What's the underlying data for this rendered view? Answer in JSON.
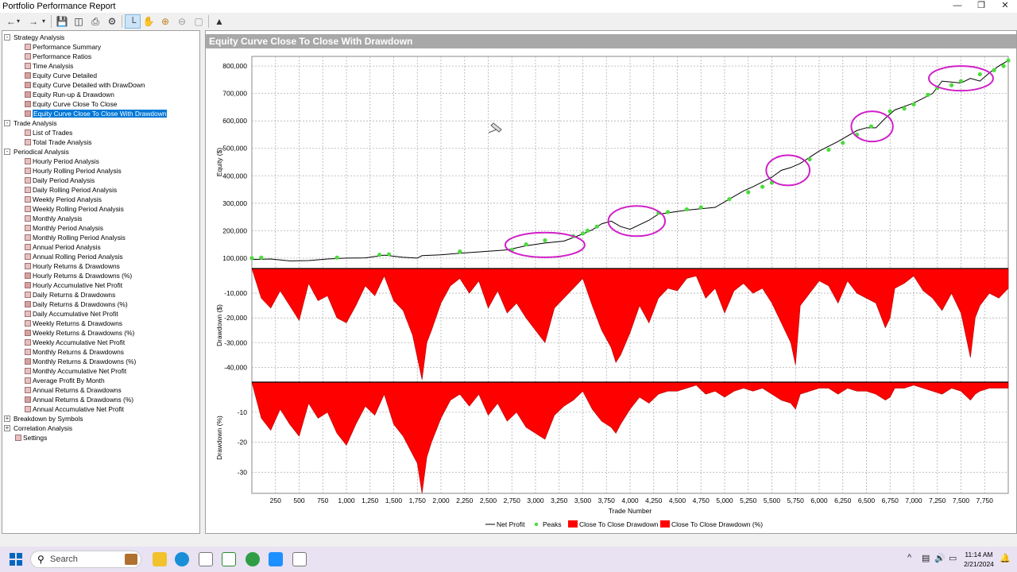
{
  "window": {
    "title": "Portfolio Performance Report"
  },
  "toolbar": {
    "buttons": [
      "back-icon",
      "forward-icon",
      "dropdown-icon",
      "save-icon",
      "export-icon",
      "print-icon",
      "settings-icon",
      "crosshair-icon",
      "pan-icon",
      "zoom-in-icon",
      "zoom-out-icon",
      "zoom-reset-icon",
      "chart-icon"
    ]
  },
  "tree": {
    "nodes": [
      {
        "label": "Strategy Analysis",
        "level": 0,
        "expander": "-"
      },
      {
        "label": "Performance Summary",
        "level": 1
      },
      {
        "label": "Performance Ratios",
        "level": 1
      },
      {
        "label": "Time Analysis",
        "level": 1
      },
      {
        "label": "Equity Curve Detailed",
        "level": 1,
        "checked": true
      },
      {
        "label": "Equity Curve Detailed with DrawDown",
        "level": 1,
        "checked": true
      },
      {
        "label": "Equity Run-up & Drawdown",
        "level": 1,
        "checked": true
      },
      {
        "label": "Equity Curve Close To Close",
        "level": 1,
        "checked": true
      },
      {
        "label": "Equity Curve Close To Close With Drawdown",
        "level": 1,
        "checked": true,
        "selected": true
      },
      {
        "label": "Trade Analysis",
        "level": 0,
        "expander": "-"
      },
      {
        "label": "List of Trades",
        "level": 1
      },
      {
        "label": "Total Trade Analysis",
        "level": 1
      },
      {
        "label": "Periodical Analysis",
        "level": 0,
        "expander": "-"
      },
      {
        "label": "Hourly Period Analysis",
        "level": 1
      },
      {
        "label": "Hourly Rolling Period Analysis",
        "level": 1
      },
      {
        "label": "Daily Period Analysis",
        "level": 1
      },
      {
        "label": "Daily Rolling Period Analysis",
        "level": 1
      },
      {
        "label": "Weekly Period Analysis",
        "level": 1
      },
      {
        "label": "Weekly Rolling Period Analysis",
        "level": 1
      },
      {
        "label": "Monthly Analysis",
        "level": 1
      },
      {
        "label": "Monthly Period Analysis",
        "level": 1
      },
      {
        "label": "Monthly Rolling Period Analysis",
        "level": 1
      },
      {
        "label": "Annual Period Analysis",
        "level": 1
      },
      {
        "label": "Annual Rolling Period Analysis",
        "level": 1
      },
      {
        "label": "Hourly Returns & Drawdowns",
        "level": 1
      },
      {
        "label": "Hourly Returns & Drawdowns (%)",
        "level": 1,
        "checked": true
      },
      {
        "label": "Hourly Accumulative Net Profit",
        "level": 1,
        "checked": true
      },
      {
        "label": "Daily Returns & Drawdowns",
        "level": 1
      },
      {
        "label": "Daily Returns & Drawdowns (%)",
        "level": 1,
        "checked": true
      },
      {
        "label": "Daily Accumulative Net Profit",
        "level": 1
      },
      {
        "label": "Weekly Returns & Drawdowns",
        "level": 1
      },
      {
        "label": "Weekly Returns & Drawdowns (%)",
        "level": 1,
        "checked": true
      },
      {
        "label": "Weekly Accumulative Net Profit",
        "level": 1
      },
      {
        "label": "Monthly Returns & Drawdowns",
        "level": 1
      },
      {
        "label": "Monthly Returns & Drawdowns (%)",
        "level": 1,
        "checked": true
      },
      {
        "label": "Monthly Accumulative Net Profit",
        "level": 1
      },
      {
        "label": "Average Profit By Month",
        "level": 1
      },
      {
        "label": "Annual Returns & Drawdowns",
        "level": 1
      },
      {
        "label": "Annual Returns & Drawdowns (%)",
        "level": 1,
        "checked": true
      },
      {
        "label": "Annual Accumulative Net Profit",
        "level": 1
      },
      {
        "label": "Breakdown by Symbols",
        "level": 0,
        "expander": "+"
      },
      {
        "label": "Correlation Analysis",
        "level": 0,
        "expander": "+"
      },
      {
        "label": "Settings",
        "level": 0.5
      }
    ]
  },
  "chart_header": "Equity Curve Close To Close With Drawdown",
  "chart_data": {
    "type": "line",
    "title": "Equity Curve Close To Close With Drawdown",
    "xlabel": "Trade Number",
    "x_ticks": [
      "250",
      "500",
      "750",
      "1,000",
      "1,250",
      "1,500",
      "1,750",
      "2,000",
      "2,250",
      "2,500",
      "2,750",
      "3,000",
      "3,250",
      "3,500",
      "3,750",
      "4,000",
      "4,250",
      "4,500",
      "4,750",
      "5,000",
      "5,250",
      "5,500",
      "5,750",
      "6,000",
      "6,250",
      "6,500",
      "6,750",
      "7,000",
      "7,250",
      "7,500",
      "7,750"
    ],
    "xlim": [
      0,
      8000
    ],
    "panels": [
      {
        "ylabel": "Equity ($)",
        "y_ticks": [
          "100,000",
          "200,000",
          "300,000",
          "400,000",
          "500,000",
          "600,000",
          "700,000",
          "800,000"
        ],
        "ylim": [
          65000,
          835000
        ],
        "series": [
          {
            "name": "Net Profit",
            "x": [
              0,
              200,
              400,
              600,
              800,
              1000,
              1200,
              1400,
              1600,
              1750,
              1800,
              2000,
              2200,
              2500,
              2700,
              2900,
              3100,
              3300,
              3500,
              3600,
              3700,
              3800,
              3900,
              4000,
              4200,
              4300,
              4600,
              4900,
              5000,
              5200,
              5300,
              5500,
              5600,
              5700,
              5800,
              6000,
              6200,
              6400,
              6500,
              6600,
              6700,
              6800,
              7000,
              7200,
              7300,
              7500,
              7600,
              7700,
              7800,
              7900,
              8000
            ],
            "y": [
              95000,
              97000,
              90000,
              91000,
              97000,
              100000,
              101000,
              111000,
              103000,
              100000,
              109000,
              112000,
              118000,
              125000,
              130000,
              145000,
              155000,
              162000,
              188000,
              203000,
              225000,
              235000,
              215000,
              205000,
              238000,
              260000,
              275000,
              285000,
              305000,
              345000,
              360000,
              395000,
              420000,
              430000,
              445000,
              490000,
              525000,
              565000,
              575000,
              575000,
              610000,
              640000,
              665000,
              700000,
              745000,
              738000,
              755000,
              745000,
              775000,
              800000,
              820000
            ]
          },
          {
            "name": "Peaks",
            "x": [
              0,
              100,
              900,
              1350,
              1450,
              2200,
              2750,
              2900,
              3100,
              3400,
              3500,
              3550,
              3650,
              4300,
              4400,
              4600,
              4750,
              5050,
              5250,
              5400,
              5500,
              5900,
              6100,
              6250,
              6400,
              6550,
              6750,
              6900,
              7000,
              7150,
              7250,
              7400,
              7500,
              7700,
              7850,
              7950,
              8000
            ],
            "y": [
              100000,
              102000,
              102000,
              112000,
              114000,
              124000,
              130000,
              150000,
              165000,
              180000,
              190000,
              200000,
              215000,
              265000,
              268000,
              278000,
              285000,
              315000,
              340000,
              360000,
              375000,
              460000,
              495000,
              520000,
              550000,
              580000,
              635000,
              645000,
              660000,
              695000,
              720000,
              730000,
              745000,
              770000,
              785000,
              800000,
              820000
            ]
          }
        ]
      },
      {
        "ylabel": "Drawdown ($)",
        "y_ticks": [
          "-10,000",
          "-20,000",
          "-30,000",
          "-40,000"
        ],
        "ylim": [
          -46000,
          0
        ],
        "series": [
          {
            "name": "Close To Close Drawdown",
            "x": [
              0,
              100,
              200,
              300,
              400,
              500,
              600,
              700,
              800,
              900,
              1000,
              1100,
              1200,
              1300,
              1400,
              1500,
              1600,
              1700,
              1750,
              1800,
              1850,
              1900,
              2000,
              2100,
              2200,
              2300,
              2400,
              2500,
              2600,
              2700,
              2800,
              2900,
              3000,
              3100,
              3200,
              3300,
              3400,
              3500,
              3600,
              3700,
              3800,
              3850,
              3900,
              4000,
              4100,
              4200,
              4300,
              4400,
              4500,
              4600,
              4700,
              4800,
              4900,
              5000,
              5100,
              5200,
              5300,
              5400,
              5500,
              5600,
              5700,
              5750,
              5800,
              5900,
              6000,
              6100,
              6200,
              6300,
              6400,
              6500,
              6600,
              6700,
              6750,
              6800,
              6900,
              7000,
              7100,
              7200,
              7300,
              7400,
              7500,
              7600,
              7650,
              7700,
              7800,
              7900,
              8000
            ],
            "y": [
              0,
              -12000,
              -16000,
              -9000,
              -15000,
              -21000,
              -6000,
              -13000,
              -11000,
              -20000,
              -22000,
              -15000,
              -7000,
              -11000,
              -3000,
              -13000,
              -17000,
              -27000,
              -36000,
              -45000,
              -30000,
              -25000,
              -14000,
              -7000,
              -4000,
              -10000,
              -5000,
              -16000,
              -9000,
              -18000,
              -14000,
              -20000,
              -25000,
              -30000,
              -16000,
              -12000,
              -8000,
              -4000,
              -15000,
              -25000,
              -32000,
              -38000,
              -35000,
              -26000,
              -15000,
              -22000,
              -12000,
              -8000,
              -9000,
              -4000,
              -3000,
              -12000,
              -8000,
              -18000,
              -9000,
              -6000,
              -10000,
              -8000,
              -14000,
              -22000,
              -30000,
              -39000,
              -15000,
              -10000,
              -5000,
              -7000,
              -14000,
              -5000,
              -10000,
              -12000,
              -14000,
              -24000,
              -20000,
              -8000,
              -6000,
              -3000,
              -9000,
              -12000,
              -17000,
              -10000,
              -18000,
              -36000,
              -20000,
              -15000,
              -10000,
              -12000,
              -8000
            ]
          }
        ]
      },
      {
        "ylabel": "Drawdown (%)",
        "y_ticks": [
          "-10",
          "-20",
          "-30"
        ],
        "ylim": [
          -37,
          0
        ],
        "series": [
          {
            "name": "Close To Close Drawdown (%)",
            "x": [
              0,
              100,
              200,
              300,
              400,
              500,
              600,
              700,
              800,
              900,
              1000,
              1100,
              1200,
              1300,
              1400,
              1500,
              1600,
              1700,
              1750,
              1800,
              1850,
              1900,
              2000,
              2100,
              2200,
              2300,
              2400,
              2500,
              2600,
              2700,
              2800,
              2900,
              3000,
              3100,
              3200,
              3300,
              3400,
              3500,
              3600,
              3700,
              3800,
              3850,
              3900,
              4000,
              4100,
              4200,
              4300,
              4400,
              4500,
              4600,
              4700,
              4800,
              4900,
              5000,
              5100,
              5200,
              5300,
              5400,
              5500,
              5600,
              5700,
              5750,
              5800,
              5900,
              6000,
              6100,
              6200,
              6300,
              6400,
              6500,
              6600,
              6700,
              6750,
              6800,
              6900,
              7000,
              7100,
              7200,
              7300,
              7400,
              7500,
              7600,
              7650,
              7700,
              7800,
              7900,
              8000
            ],
            "y": [
              0,
              -12,
              -16,
              -9,
              -14,
              -18,
              -7,
              -12,
              -10,
              -17,
              -21,
              -14,
              -8,
              -11,
              -4,
              -14,
              -18,
              -24,
              -27,
              -37,
              -25,
              -20,
              -12,
              -6,
              -4,
              -8,
              -4,
              -11,
              -7,
              -13,
              -10,
              -15,
              -17,
              -19,
              -11,
              -8,
              -6,
              -3,
              -9,
              -13,
              -15,
              -17,
              -14,
              -9,
              -5,
              -7,
              -4,
              -3,
              -3,
              -2,
              -1,
              -4,
              -3,
              -5,
              -3,
              -2,
              -3,
              -2,
              -4,
              -6,
              -7,
              -9,
              -4,
              -3,
              -2,
              -2,
              -4,
              -2,
              -3,
              -3,
              -4,
              -6,
              -5,
              -2,
              -2,
              -1,
              -2,
              -3,
              -4,
              -2,
              -3,
              -6,
              -4,
              -3,
              -2,
              -2,
              -2
            ]
          }
        ]
      }
    ],
    "legend": {
      "placement": "bottom-center",
      "entries": [
        "Net Profit",
        "Peaks",
        "Close To Close Drawdown",
        "Close To Close Drawdown (%)"
      ]
    },
    "colors": {
      "net_profit": "#000000",
      "peaks": "#4cdc3c",
      "drawdown": "#ff0000",
      "annotation": "#d020c8"
    }
  },
  "taskbar": {
    "search_placeholder": "Search",
    "apps": [
      "windows-start-icon",
      "briefcase-icon",
      "file-explorer-icon",
      "edge-browser-icon",
      "document-icon",
      "app-icon",
      "chrome-icon",
      "app-icon-2",
      "document-icon-2"
    ],
    "tray_chevron": "^",
    "time": "11:14 AM",
    "date": "2/21/2024"
  }
}
